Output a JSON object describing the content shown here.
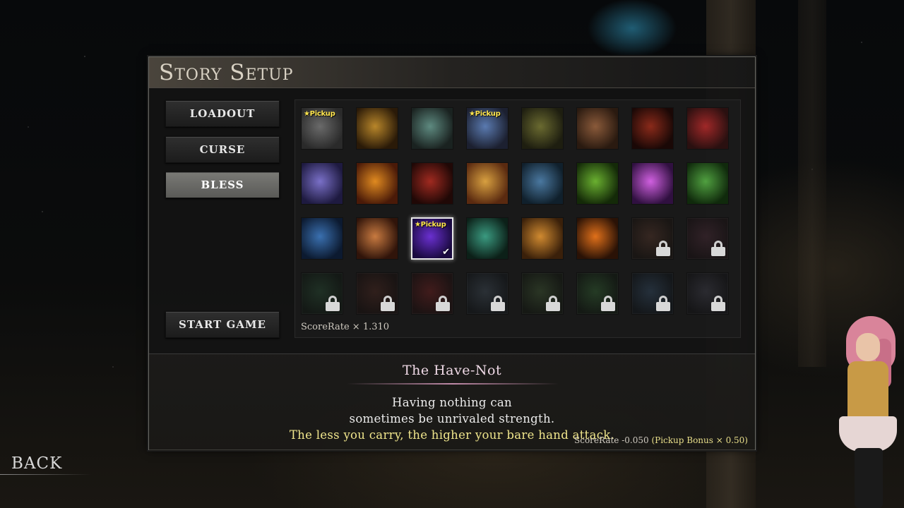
{
  "screen": {
    "title": "Story Setup",
    "back_label": "BACK"
  },
  "menu": {
    "loadout": "LOADOUT",
    "curse": "CURSE",
    "bless": "BLESS",
    "start_game": "START GAME",
    "active": "bless"
  },
  "grid": {
    "scorerate": "ScoreRate × 1.310",
    "pickup_label": "★Pickup",
    "items": [
      {
        "icon": "gauntlet-icon",
        "color": "#6a6a6a",
        "color2": "#2a2a2a",
        "pickup": true,
        "locked": false
      },
      {
        "icon": "golden-demon-icon",
        "color": "#b8862a",
        "color2": "#2a1a08",
        "pickup": false,
        "locked": false
      },
      {
        "icon": "feather-icon",
        "color": "#5e8a80",
        "color2": "#1a2220",
        "pickup": false,
        "locked": false
      },
      {
        "icon": "potions-icon",
        "color": "#5a7ab0",
        "color2": "#1c2030",
        "pickup": true,
        "locked": false
      },
      {
        "icon": "coins-icon",
        "color": "#6a6a30",
        "color2": "#1e1e10",
        "pickup": false,
        "locked": false
      },
      {
        "icon": "sword-icon",
        "color": "#8a5a3a",
        "color2": "#2a1a10",
        "pickup": false,
        "locked": false
      },
      {
        "icon": "flame-demon-icon",
        "color": "#8a2a1a",
        "color2": "#1a0806",
        "pickup": false,
        "locked": false
      },
      {
        "icon": "axe-icon",
        "color": "#a02828",
        "color2": "#2a1010",
        "pickup": false,
        "locked": false
      },
      {
        "icon": "spirit-wolf-icon",
        "color": "#7a70c8",
        "color2": "#1e1a40",
        "pickup": false,
        "locked": false
      },
      {
        "icon": "fire-orb-icon",
        "color": "#e08a20",
        "color2": "#4a1a08",
        "pickup": false,
        "locked": false
      },
      {
        "icon": "warrior-silhouette-icon",
        "color": "#a02a20",
        "color2": "#200806",
        "pickup": false,
        "locked": false
      },
      {
        "icon": "golden-blade-icon",
        "color": "#d8a040",
        "color2": "#5a2a10",
        "pickup": false,
        "locked": false
      },
      {
        "icon": "howling-wolf-icon",
        "color": "#4a78a0",
        "color2": "#10202c",
        "pickup": false,
        "locked": false
      },
      {
        "icon": "green-burst-icon",
        "color": "#6ab030",
        "color2": "#142a08",
        "pickup": false,
        "locked": false
      },
      {
        "icon": "magic-aura-icon",
        "color": "#d060e0",
        "color2": "#301040",
        "pickup": false,
        "locked": false
      },
      {
        "icon": "nature-spirit-icon",
        "color": "#50a040",
        "color2": "#102a0c",
        "pickup": false,
        "locked": false
      },
      {
        "icon": "holy-book-icon",
        "color": "#3a70b0",
        "color2": "#0c1a30",
        "pickup": false,
        "locked": false
      },
      {
        "icon": "screaming-face-icon",
        "color": "#c87a40",
        "color2": "#30140a",
        "pickup": false,
        "locked": false
      },
      {
        "icon": "empty-hand-icon",
        "color": "#6a30d0",
        "color2": "#1a0a40",
        "pickup": true,
        "locked": false,
        "selected": true
      },
      {
        "icon": "rune-web-icon",
        "color": "#3a9a80",
        "color2": "#0c2018",
        "pickup": false,
        "locked": false
      },
      {
        "icon": "flexed-arm-icon",
        "color": "#d08a30",
        "color2": "#3a200a",
        "pickup": false,
        "locked": false
      },
      {
        "icon": "claw-marks-icon",
        "color": "#e0701a",
        "color2": "#2a1206",
        "pickup": false,
        "locked": false
      },
      {
        "icon": "locked-icon",
        "color": "#6a4030",
        "color2": "#1a100a",
        "pickup": false,
        "locked": true
      },
      {
        "icon": "locked-icon",
        "color": "#5a3040",
        "color2": "#1a0c10",
        "pickup": false,
        "locked": true
      },
      {
        "icon": "locked-icon",
        "color": "#2a5a3a",
        "color2": "#0a180e",
        "pickup": false,
        "locked": true
      },
      {
        "icon": "locked-icon",
        "color": "#5a2a20",
        "color2": "#180a08",
        "pickup": false,
        "locked": true
      },
      {
        "icon": "locked-icon",
        "color": "#8a2020",
        "color2": "#200808",
        "pickup": false,
        "locked": true
      },
      {
        "icon": "locked-icon",
        "color": "#4a5a6a",
        "color2": "#10161c",
        "pickup": false,
        "locked": true
      },
      {
        "icon": "locked-icon",
        "color": "#4a6a3a",
        "color2": "#10180c",
        "pickup": false,
        "locked": true
      },
      {
        "icon": "locked-icon",
        "color": "#3a7a3a",
        "color2": "#0c1a0c",
        "pickup": false,
        "locked": true
      },
      {
        "icon": "locked-icon",
        "color": "#3a5a7a",
        "color2": "#0c141c",
        "pickup": false,
        "locked": true
      },
      {
        "icon": "locked-icon",
        "color": "#4a4a5a",
        "color2": "#101014",
        "pickup": false,
        "locked": true
      }
    ]
  },
  "description": {
    "title": "The Have-Not",
    "line1": "Having nothing can",
    "line2": "sometimes be unrivaled strength.",
    "line3": "The less you carry, the higher your bare hand attack.",
    "score_prefix": "ScoreRate  -0.050 ",
    "score_bonus": "(Pickup Bonus × 0.50)"
  }
}
